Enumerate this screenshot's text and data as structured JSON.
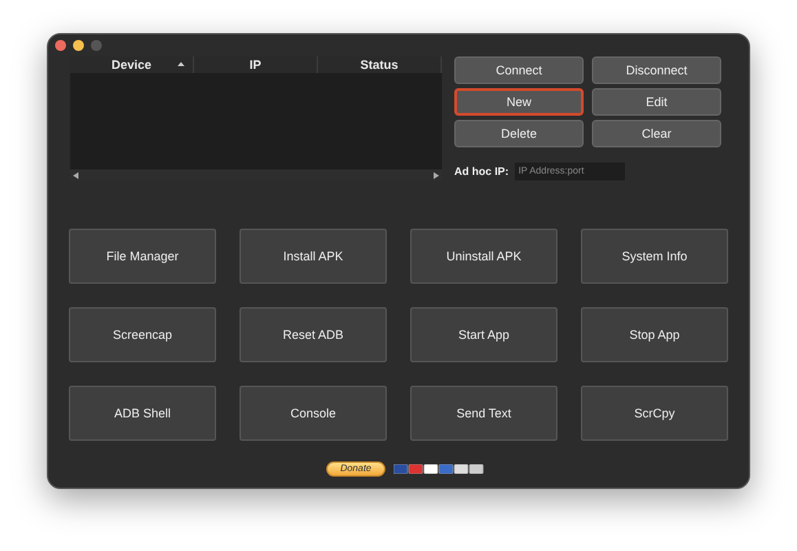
{
  "table": {
    "columns": [
      {
        "label": "Device",
        "sorted": true
      },
      {
        "label": "IP",
        "sorted": false
      },
      {
        "label": "Status",
        "sorted": false
      }
    ]
  },
  "device_buttons": [
    {
      "label": "Connect",
      "focused": false
    },
    {
      "label": "Disconnect",
      "focused": false
    },
    {
      "label": "New",
      "focused": true
    },
    {
      "label": "Edit",
      "focused": false
    },
    {
      "label": "Delete",
      "focused": false
    },
    {
      "label": "Clear",
      "focused": false
    }
  ],
  "adhoc": {
    "label": "Ad hoc IP:",
    "placeholder": "IP Address:port"
  },
  "actions": [
    "File Manager",
    "Install APK",
    "Uninstall APK",
    "System Info",
    "Screencap",
    "Reset ADB",
    "Start App",
    "Stop App",
    "ADB Shell",
    "Console",
    "Send Text",
    "ScrCpy"
  ],
  "donate": {
    "label": "Donate"
  }
}
